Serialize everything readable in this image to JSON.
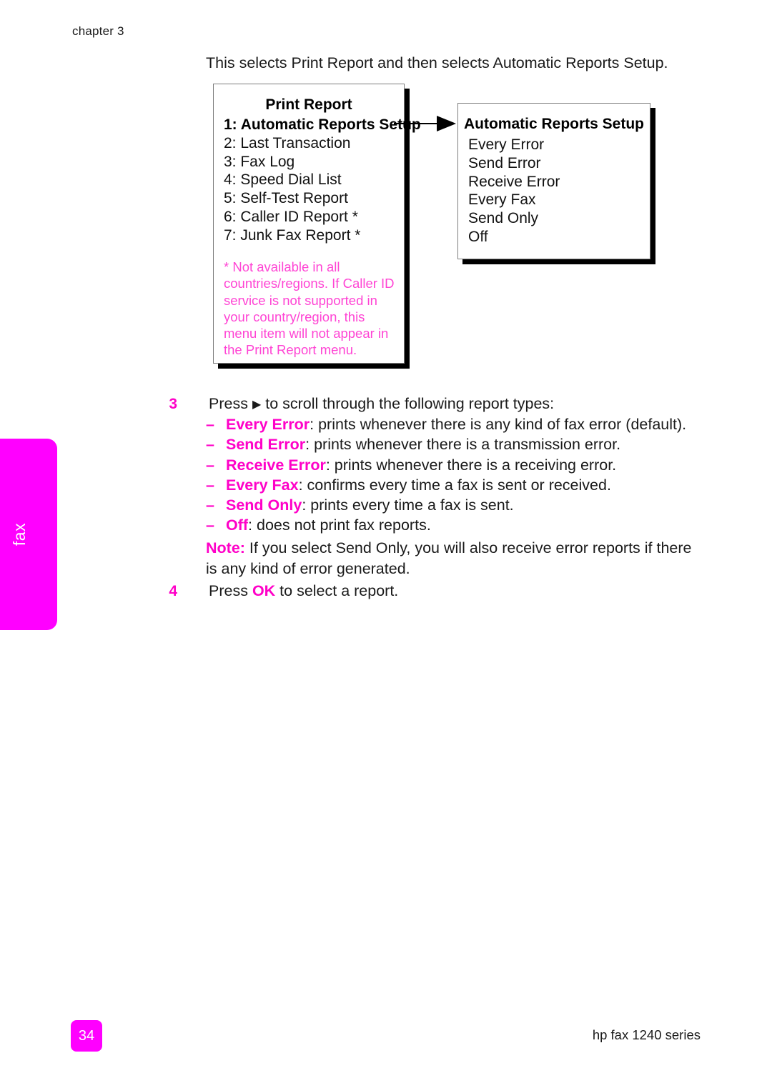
{
  "page": {
    "chapter_head": "chapter 3",
    "side_tab_label": "fax",
    "page_number": "34",
    "footer_right": "hp fax 1240 series"
  },
  "intro": {
    "text": "This selects Print Report and then selects Automatic Reports Setup."
  },
  "print_report_box": {
    "title": "Print Report",
    "items": [
      "1: Automatic Reports Setup",
      "2: Last Transaction",
      "3: Fax Log",
      "4: Speed Dial List",
      "5: Self-Test Report",
      "6: Caller ID Report *",
      "7: Junk Fax Report *"
    ],
    "selected_index": 0,
    "footnote": "* Not available in all countries/regions. If Caller ID service is not supported in your country/region, this menu item will not appear in the Print Report menu."
  },
  "auto_reports_box": {
    "title": "Automatic Reports Setup",
    "items": [
      "Every Error",
      "Send Error",
      "Receive Error",
      "Every Fax",
      "Send Only",
      "Off"
    ]
  },
  "steps": {
    "step3": {
      "number": "3",
      "text_before": "Press ",
      "arrow_glyph": "▶",
      "text_after": " to scroll through the following report types:"
    },
    "step4": {
      "number": "4",
      "text_before": "Press ",
      "key": "OK",
      "text_after": " to select a report."
    }
  },
  "report_types": {
    "dash": "–",
    "rows": [
      {
        "term": "Every Error",
        "desc": ": prints whenever there is any kind of fax error (default)."
      },
      {
        "term": "Send Error",
        "desc": ": prints whenever there is a transmission error."
      },
      {
        "term": "Receive Error",
        "desc": ": prints whenever there is a receiving error."
      },
      {
        "term": "Every Fax",
        "desc": ": confirms every time a fax is sent or received."
      },
      {
        "term": "Send Only",
        "desc": ": prints every time a fax is sent."
      },
      {
        "term": "Off",
        "desc": ": does not print fax reports."
      }
    ]
  },
  "note": {
    "label": "Note:",
    "text": " If you select Send Only, you will also receive error reports if there is any kind of error generated."
  },
  "colors": {
    "magenta_accent": "#ff00c8",
    "magenta_tab": "#ff00ff",
    "footnote_pink": "#ff44d4",
    "body_text": "#1a1a1a"
  }
}
